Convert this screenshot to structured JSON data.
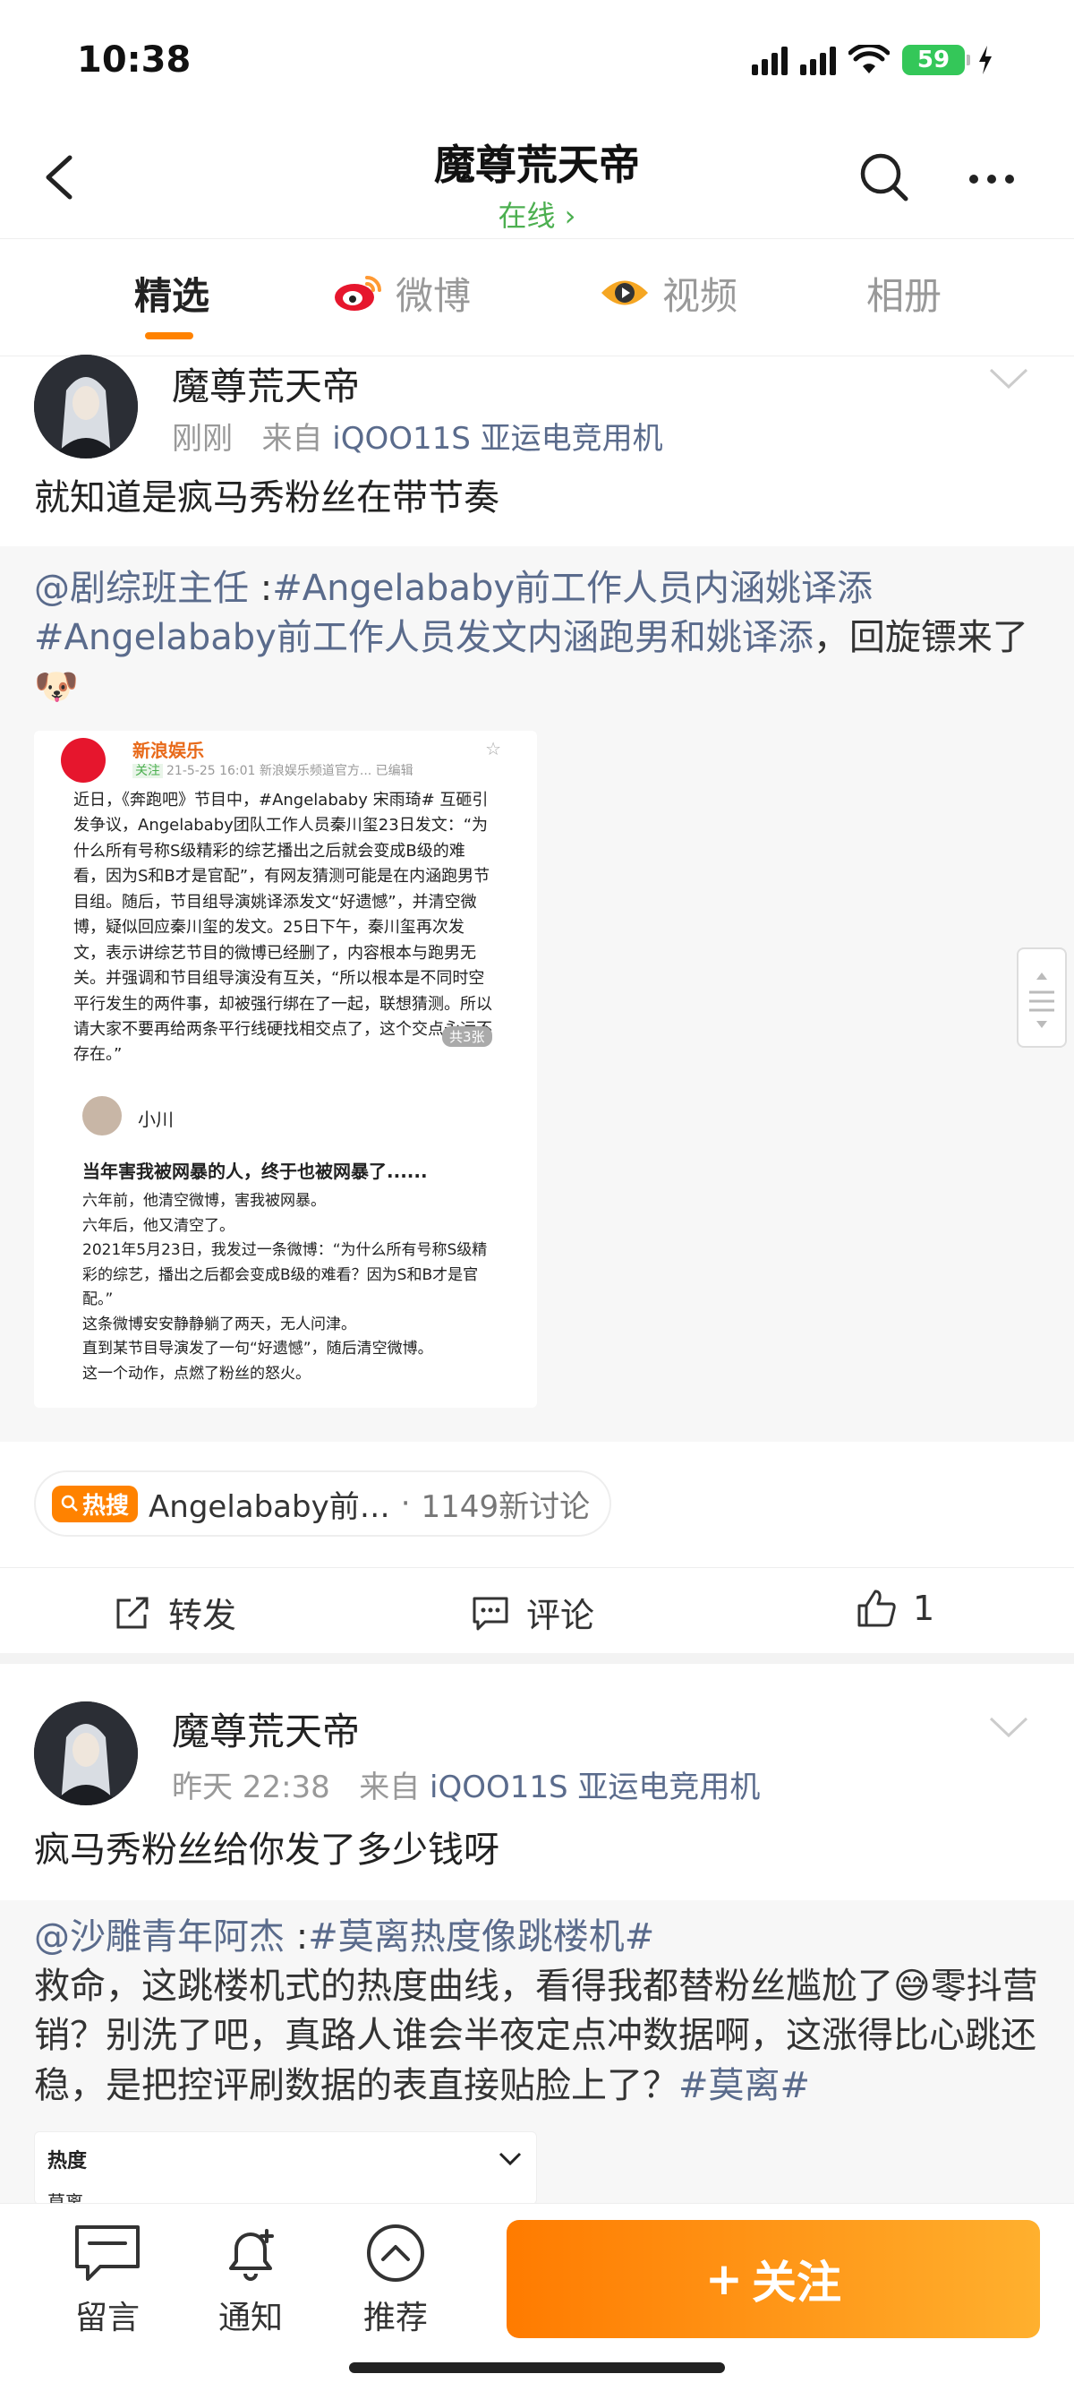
{
  "status_bar": {
    "time": "10:38",
    "battery": "59"
  },
  "header": {
    "title": "魔尊荒天帝",
    "status": "在线 ›"
  },
  "tabs": [
    {
      "label": "精选",
      "active": true
    },
    {
      "label": "微博",
      "icon": "weibo-logo-icon"
    },
    {
      "label": "视频",
      "icon": "video-eye-icon"
    },
    {
      "label": "相册"
    }
  ],
  "posts": [
    {
      "username": "魔尊荒天帝",
      "time": "刚刚",
      "source_prefix": "来自",
      "source": "iQOO11S 亚运电竞用机",
      "text": "就知道是疯马秀粉丝在带节奏",
      "repost": {
        "author": "@剧综班主任",
        "colon": " :",
        "tag": "#Angelababy前工作人员内涵姚译添",
        "tag2": "#Angelababy前工作人员发文内涵跑男和姚译添",
        "rest": "，回旋镖来了🐶"
      },
      "screenshot": {
        "account": "新浪娱乐",
        "badge": "关注",
        "meta": "21-5-25 16:01 新浪娱乐频道官方... 已编辑",
        "body": "近日，《奔跑吧》节目中，#Angelababy 宋雨琦# 互砸引发争议，Angelababy团队工作人员秦川玺23日发文：“为什么所有号称S级精彩的综艺播出之后就会变成B级的难看，因为S和B才是官配”，有网友猜测可能是在内涵跑男节目组。随后，节目组导演姚译添发文“好遗憾”，并清空微博，疑似回应秦川玺的发文。25日下午，秦川玺再次发文，表示讲综艺节目的微博已经删了，内容根本与跑男无关。并强调和节目组导演没有互关，“所以根本是不同时空平行发生的两件事，却被强行绑在了一起，联想猜测。所以请大家不要再给两条平行线硬找相交点了，这个交点永远不存在。”",
        "count": "共3张",
        "user2": "小川",
        "headline": "当年害我被网暴的人，终于也被网暴了......",
        "lines": [
          "六年前，他清空微博，害我被网暴。",
          "六年后，他又清空了。",
          "2021年5月23日，我发过一条微博：“为什么所有号称S级精彩的综艺，播出之后都会变成B级的难看？因为S和B才是官配。”",
          "这条微博安安静静躺了两天，无人问津。",
          "直到某节目导演发了一句“好遗憾”，随后清空微博。",
          "这一个动作，点燃了粉丝的怒火。"
        ]
      },
      "hot": {
        "badge": "热搜",
        "topic": "Angelababy前…",
        "dot": "·",
        "count": "1149新讨论"
      },
      "actions": {
        "repost": "转发",
        "comment": "评论",
        "likes": "1"
      }
    },
    {
      "username": "魔尊荒天帝",
      "time": "昨天 22:38",
      "source_prefix": "来自",
      "source": "iQOO11S 亚运电竞用机",
      "text": "疯马秀粉丝给你发了多少钱呀",
      "repost": {
        "author": "@沙雕青年阿杰",
        "colon": " :",
        "tag": "#莫离热度像跳楼机#",
        "rest": "救命，这跳楼机式的热度曲线，看得我都替粉丝尴尬了😅零抖营销？别洗了吧，真路人谁会半夜定点冲数据啊，这涨得比心跳还稳，是把控评刷数据的表直接贴脸上了？",
        "tag2": "#莫离#"
      },
      "card": {
        "label": "热度",
        "label2": "莫离"
      }
    }
  ],
  "bottom_bar": {
    "message": "留言",
    "notify": "通知",
    "recommend": "推荐",
    "follow": "关注",
    "follow_plus": "+"
  }
}
